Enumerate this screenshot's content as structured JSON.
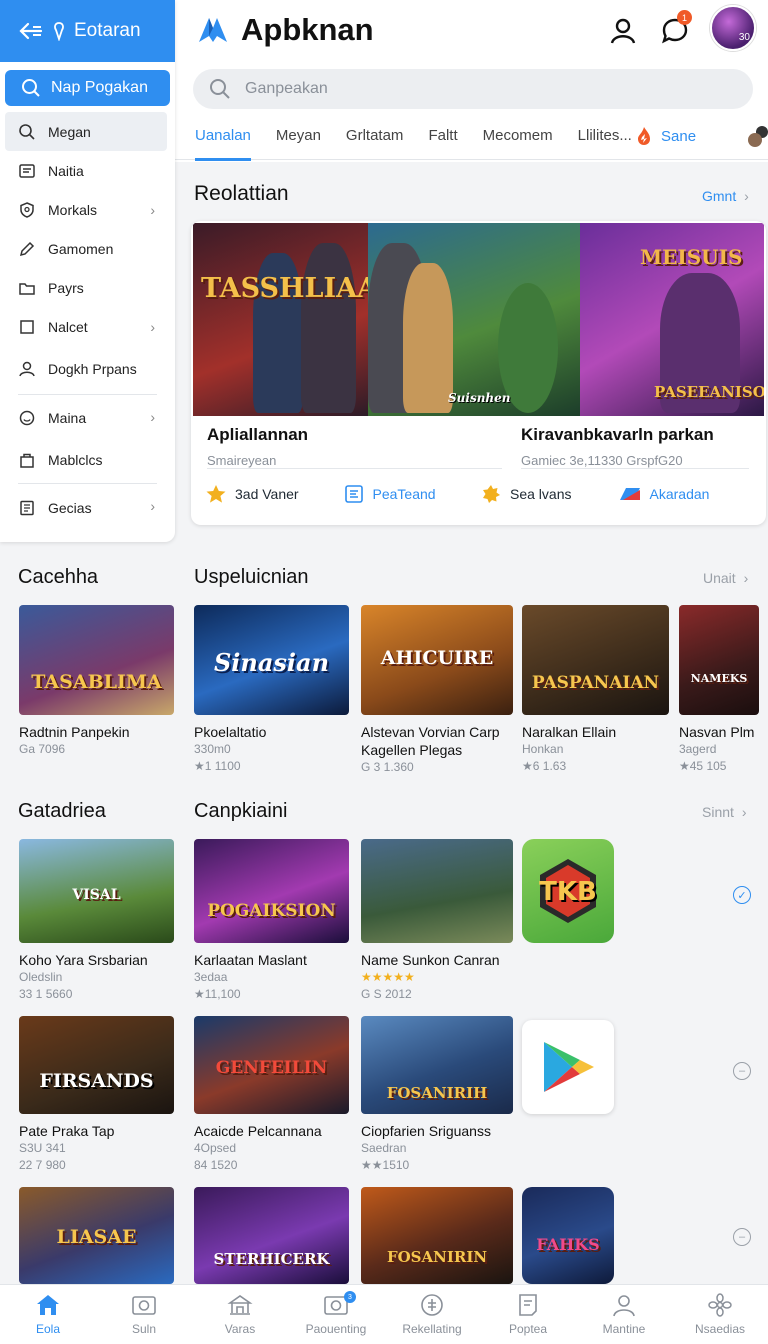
{
  "sidebar": {
    "title": "Eotaran",
    "search_label": "Nap Pogakan",
    "items": [
      {
        "label": "Megan",
        "icon": "search-icon"
      },
      {
        "label": "Naitia",
        "icon": "list-icon"
      },
      {
        "label": "Morkals",
        "icon": "shield-icon"
      },
      {
        "label": "Gamomen",
        "icon": "pen-icon"
      },
      {
        "label": "Payrs",
        "icon": "folder-icon"
      },
      {
        "label": "Nalcet",
        "icon": "square-icon"
      },
      {
        "label": "Dogkh Prpans",
        "icon": "user-icon"
      },
      {
        "label": "Maina",
        "icon": "smile-icon"
      },
      {
        "label": "Mablclcs",
        "icon": "bag-icon"
      },
      {
        "label": "Gecias",
        "icon": "book-icon"
      }
    ]
  },
  "header": {
    "brand": "Apbknan",
    "notification_count": "1",
    "avatar_badge": "30"
  },
  "search": {
    "placeholder": "Ganpeakan"
  },
  "tabs": [
    {
      "label": "Uanalan"
    },
    {
      "label": "Meyan"
    },
    {
      "label": "Grltatam"
    },
    {
      "label": "Faltt"
    },
    {
      "label": "Mecomem"
    },
    {
      "label": "Llilites..."
    }
  ],
  "tab_extra": {
    "label": "Sane"
  },
  "featured": {
    "section_title": "Reolattian",
    "section_link": "Gmnt",
    "banner_texts": [
      "TASSHLIAA",
      "Suisnhen",
      "MEISUIS",
      "PASEEANISON"
    ],
    "left_title": "Apliallannan",
    "left_sub": "Smaireyean",
    "right_title": "Kiravanbkavarln parkan",
    "right_sub": "Gamiec 3e,11330 GrspfG20",
    "actions": [
      {
        "label": "3ad Vaner",
        "icon": "star-icon"
      },
      {
        "label": "PeaTeand",
        "icon": "document-icon"
      },
      {
        "label": "Sea lvans",
        "icon": "badge-icon"
      },
      {
        "label": "Akaradan",
        "icon": "flag-icon"
      }
    ]
  },
  "sections": {
    "s1_left": "Cacehha",
    "s1_title": "Uspeluicnian",
    "s1_link": "Unait",
    "s2_left": "Gatadriea",
    "s2_title": "Canpkiaini",
    "s2_link": "Sinnt"
  },
  "row1": [
    {
      "thumb": "TASABLIMA",
      "name": "Radtnin Panpekin",
      "meta1": "Ga 7096",
      "meta2": ""
    },
    {
      "thumb": "Sinasian",
      "name": "Pkoelaltatio",
      "meta1": "330m0",
      "meta2": "★1 1100"
    },
    {
      "thumb": "AHICUIRE",
      "name": "Alstevan Vorvian Carp Kagellen Plegas",
      "meta1": "G 3 1.360",
      "meta2": ""
    },
    {
      "thumb": "PASPANAIAN",
      "name": "Naralkan Ellain",
      "meta1": "Honkan",
      "meta2": "★6 1.63"
    },
    {
      "thumb": "NAMEKS",
      "name": "Nasvan Plm",
      "meta1": "3agerd",
      "meta2": "★45 105"
    }
  ],
  "row2": [
    {
      "thumb": "VISAL",
      "name": "Koho Yara Srsbarian",
      "meta1": "Oledslin",
      "meta2": "33 1 5660"
    },
    {
      "thumb": "POGAIKSION",
      "name": "Karlaatan Maslant",
      "meta1": "3edaa",
      "meta2": "★11,100"
    },
    {
      "thumb": "",
      "name": "Name Sunkon Canran",
      "meta1": "★★★★★",
      "meta2": "G S 2012"
    },
    {
      "thumb": "TKB",
      "name": "",
      "meta1": "",
      "meta2": ""
    }
  ],
  "row3": [
    {
      "thumb": "FIRSANDS",
      "name": "Pate Praka Tap",
      "meta1": "S3U 341",
      "meta2": "22 7 980"
    },
    {
      "thumb": "GENFEILIN",
      "name": "Acaicde Pelcannana",
      "meta1": "4Opsed",
      "meta2": "84 1520"
    },
    {
      "thumb": "FOSANIRIH",
      "name": "Ciopfarien Sriguanss",
      "meta1": "Saedran",
      "meta2": "★★1510"
    },
    {
      "thumb": "",
      "name": "",
      "meta1": "",
      "meta2": ""
    }
  ],
  "row4": [
    {
      "thumb": "LIASAE"
    },
    {
      "thumb": "STERHICERK"
    },
    {
      "thumb": "FOSANIRIN"
    },
    {
      "thumb": "FAHKS"
    }
  ],
  "bottom_nav": [
    {
      "label": "Eola",
      "icon": "home-icon"
    },
    {
      "label": "Suln",
      "icon": "camera-icon"
    },
    {
      "label": "Varas",
      "icon": "bank-icon"
    },
    {
      "label": "Paouenting",
      "icon": "camera-badge-icon",
      "badge": "3"
    },
    {
      "label": "Rekellating",
      "icon": "currency-icon"
    },
    {
      "label": "Poptea",
      "icon": "document-icon"
    },
    {
      "label": "Mantine",
      "icon": "user-icon"
    },
    {
      "label": "Nsaedias",
      "icon": "flower-icon"
    }
  ],
  "colors": {
    "accent": "#2f8ef0",
    "badge": "#f05a28",
    "star": "#f2b01e"
  }
}
